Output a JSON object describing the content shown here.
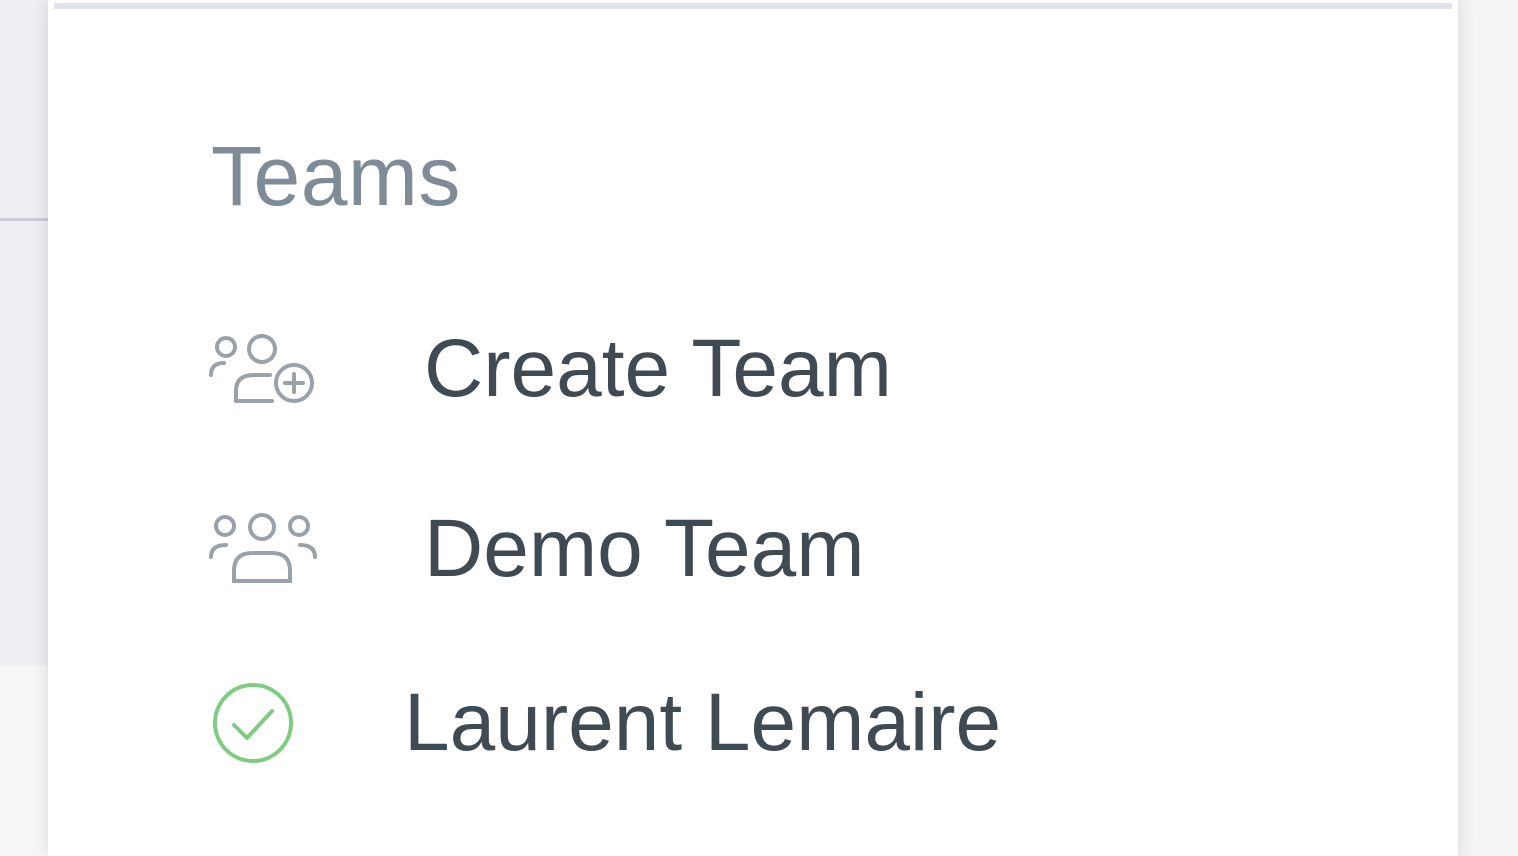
{
  "teams_menu": {
    "title": "Teams",
    "items": [
      {
        "label": "Create Team",
        "icon": "team-add-icon"
      },
      {
        "label": "Demo Team",
        "icon": "team-icon"
      },
      {
        "label": "Laurent Lemaire",
        "icon": "check-circle-icon",
        "selected": true
      }
    ]
  },
  "colors": {
    "title": "#7f8c97",
    "item_text": "#3f4a53",
    "icon_gray": "#9aa1a8",
    "check_green": "#7ecb82"
  }
}
